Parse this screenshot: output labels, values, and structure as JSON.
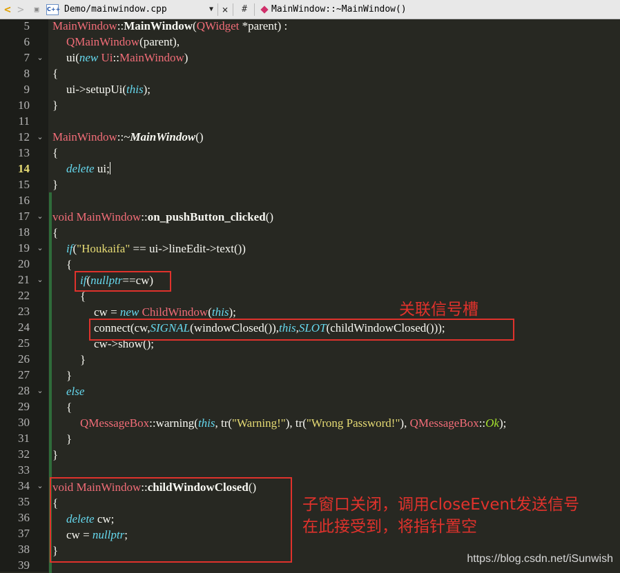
{
  "toolbar": {
    "back_icon": "chevron-left-icon",
    "back_glyph": "<",
    "forward_glyph": ">",
    "pin_glyph": "▣",
    "file_icon_text": "C++",
    "file_name": "Demo/mainwindow.cpp",
    "dropdown_glyph": "▼",
    "close_glyph": "×",
    "hash": "#",
    "symbol": "MainWindow::~MainWindow()"
  },
  "editor": {
    "current_line": 14,
    "lines": [
      {
        "n": "5",
        "fold": ""
      },
      {
        "n": "6",
        "fold": ""
      },
      {
        "n": "7",
        "fold": "⌄"
      },
      {
        "n": "8",
        "fold": ""
      },
      {
        "n": "9",
        "fold": ""
      },
      {
        "n": "10",
        "fold": ""
      },
      {
        "n": "11",
        "fold": ""
      },
      {
        "n": "12",
        "fold": "⌄"
      },
      {
        "n": "13",
        "fold": ""
      },
      {
        "n": "14",
        "fold": ""
      },
      {
        "n": "15",
        "fold": ""
      },
      {
        "n": "16",
        "fold": ""
      },
      {
        "n": "17",
        "fold": "⌄"
      },
      {
        "n": "18",
        "fold": ""
      },
      {
        "n": "19",
        "fold": "⌄"
      },
      {
        "n": "20",
        "fold": ""
      },
      {
        "n": "21",
        "fold": "⌄"
      },
      {
        "n": "22",
        "fold": ""
      },
      {
        "n": "23",
        "fold": ""
      },
      {
        "n": "24",
        "fold": ""
      },
      {
        "n": "25",
        "fold": ""
      },
      {
        "n": "26",
        "fold": ""
      },
      {
        "n": "27",
        "fold": ""
      },
      {
        "n": "28",
        "fold": "⌄"
      },
      {
        "n": "29",
        "fold": ""
      },
      {
        "n": "30",
        "fold": ""
      },
      {
        "n": "31",
        "fold": ""
      },
      {
        "n": "32",
        "fold": ""
      },
      {
        "n": "33",
        "fold": ""
      },
      {
        "n": "34",
        "fold": "⌄"
      },
      {
        "n": "35",
        "fold": ""
      },
      {
        "n": "36",
        "fold": ""
      },
      {
        "n": "37",
        "fold": ""
      },
      {
        "n": "38",
        "fold": ""
      },
      {
        "n": "39",
        "fold": ""
      }
    ],
    "code": {
      "l5": [
        "MainWindow",
        "::",
        "MainWindow",
        "(",
        "QWidget",
        " *parent) :"
      ],
      "l6": [
        "QMainWindow",
        "(parent),"
      ],
      "l7": [
        "ui(",
        "new",
        " ",
        "Ui",
        "::",
        "MainWindow",
        ")"
      ],
      "l8": "{",
      "l9": [
        "ui->setupUi(",
        "this",
        ");"
      ],
      "l10": "}",
      "l12": [
        "MainWindow",
        "::~",
        "MainWindow",
        "()"
      ],
      "l13": "{",
      "l14": [
        "delete",
        " ui;"
      ],
      "l15": "}",
      "l17": [
        "void",
        " ",
        "MainWindow",
        "::",
        "on_pushButton_clicked",
        "()"
      ],
      "l18": "{",
      "l19": [
        "if",
        "(",
        "\"Houkaifa\"",
        " == ui->lineEdit->text())"
      ],
      "l20": "{",
      "l21": [
        "if",
        "(",
        "nullptr",
        "==cw)"
      ],
      "l22": "{",
      "l23": [
        "cw = ",
        "new",
        " ",
        "ChildWindow",
        "(",
        "this",
        ");"
      ],
      "l24": [
        "connect(cw,",
        "SIGNAL",
        "(windowClosed()),",
        "this",
        ",",
        "SLOT",
        "(childWindowClosed()));"
      ],
      "l25": "cw->show();",
      "l26": "}",
      "l27": "}",
      "l28": "else",
      "l29": "{",
      "l30": [
        "QMessageBox",
        "::",
        "warning(",
        "this",
        ", tr(",
        "\"Warning!\"",
        "), tr(",
        "\"Wrong Password!\"",
        "), ",
        "QMessageBox",
        "::",
        "Ok",
        ");"
      ],
      "l31": "}",
      "l32": "}",
      "l34": [
        "void",
        " ",
        "MainWindow",
        "::",
        "childWindowClosed",
        "()"
      ],
      "l35": "{",
      "l36": [
        "delete",
        " cw;"
      ],
      "l37": [
        "cw = ",
        "nullptr",
        ";"
      ],
      "l38": "}"
    }
  },
  "annotations": {
    "note1": "关联信号槽",
    "note2_line1": "子窗口关闭，调用closeEvent发送信号",
    "note2_line2": "在此接受到，将指针置空"
  },
  "watermark": "https://blog.csdn.net/iSunwish",
  "colors": {
    "background": "#272822",
    "type": "#f26d78",
    "keyword": "#66d9ef",
    "string": "#e6db74",
    "enum": "#a6e22e",
    "annotation": "#e0322c"
  }
}
